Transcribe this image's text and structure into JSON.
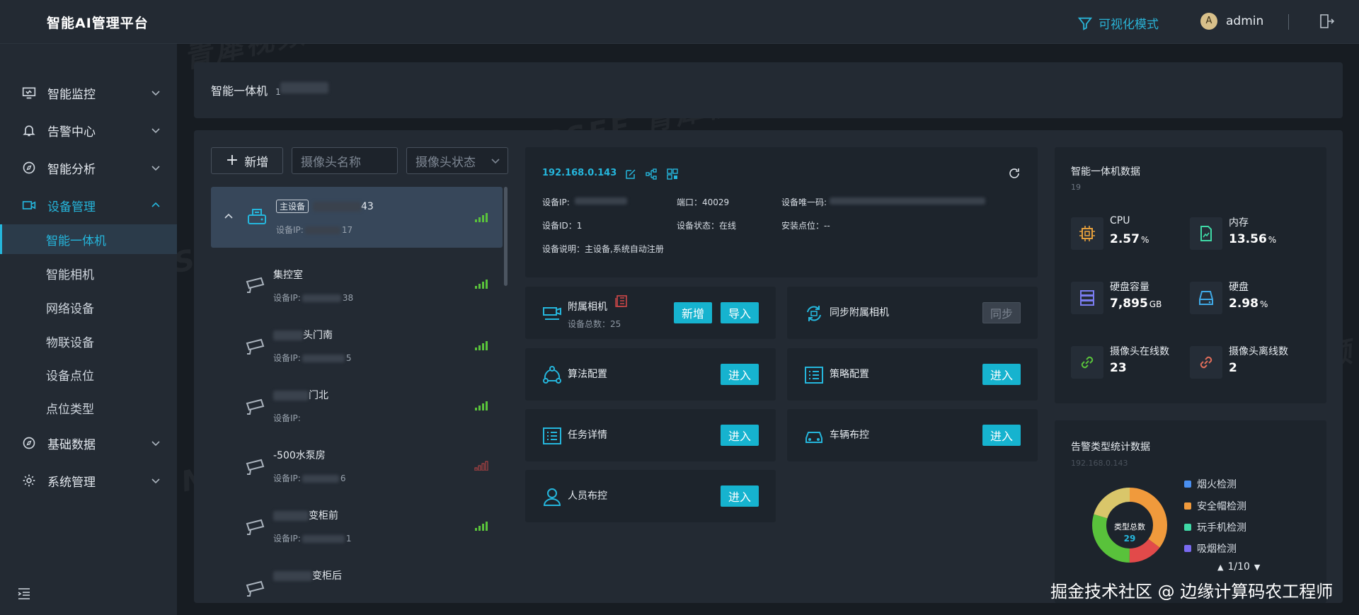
{
  "app": {
    "title": "智能AI管理平台"
  },
  "header": {
    "viz_mode": "可视化模式",
    "avatar_letter": "A",
    "username": "admin"
  },
  "sidebar": {
    "items": [
      {
        "label": "智能监控"
      },
      {
        "label": "告警中心"
      },
      {
        "label": "智能分析"
      },
      {
        "label": "设备管理"
      }
    ],
    "sub_items": [
      {
        "label": "智能一体机"
      },
      {
        "label": "智能相机"
      },
      {
        "label": "网络设备"
      },
      {
        "label": "物联设备"
      },
      {
        "label": "设备点位"
      },
      {
        "label": "点位类型"
      }
    ],
    "items_after": [
      {
        "label": "基础数据"
      },
      {
        "label": "系统管理"
      }
    ]
  },
  "breadcrumb": {
    "title": "智能一体机",
    "suffix": "1"
  },
  "toolbar": {
    "add_label": "新增",
    "name_placeholder": "摄像头名称",
    "status_placeholder": "摄像头状态"
  },
  "devices": [
    {
      "tag": "主设备",
      "name_suffix": "43",
      "ip_label": "设备IP:",
      "ip_suffix": "17",
      "signal": "good"
    },
    {
      "name": "集控室",
      "ip_label": "设备IP:",
      "ip_suffix": "38",
      "signal": "good"
    },
    {
      "name": "头门南",
      "ip_label": "设备IP:",
      "ip_suffix": "5",
      "signal": "good"
    },
    {
      "name": "门北",
      "ip_label": "设备IP:",
      "ip_suffix": "",
      "signal": "good"
    },
    {
      "name": "-500水泵房",
      "ip_label": "设备IP:",
      "ip_suffix": "6",
      "signal": "bad"
    },
    {
      "name": "变柜前",
      "ip_label": "设备IP:",
      "ip_suffix": "1",
      "signal": "good"
    },
    {
      "name": "变柜后",
      "ip_label": "",
      "ip_suffix": "",
      "signal": "good"
    }
  ],
  "detail": {
    "ip": "192.168.0.143",
    "device_ip_label": "设备IP:",
    "port": "端口：40029",
    "unique_label": "设备唯一码:",
    "device_id": "设备ID：1",
    "device_status": "设备状态：在线",
    "install": "安装点位：--",
    "desc": "设备说明：主设备,系统自动注册"
  },
  "cards": {
    "attached_camera": {
      "title": "附属相机",
      "sub": "设备总数：25",
      "add": "新增",
      "import": "导入"
    },
    "sync": {
      "title": "同步附属相机",
      "btn": "同步"
    },
    "algo": {
      "title": "算法配置",
      "btn": "进入"
    },
    "strategy": {
      "title": "策略配置",
      "btn": "进入"
    },
    "task": {
      "title": "任务详情",
      "btn": "进入"
    },
    "vehicle": {
      "title": "车辆布控",
      "btn": "进入"
    },
    "person": {
      "title": "人员布控",
      "btn": "进入"
    }
  },
  "stats": {
    "title": "智能一体机数据",
    "subtitle": "19",
    "cpu": {
      "label": "CPU",
      "value": "2.57",
      "unit": "%"
    },
    "mem": {
      "label": "内存",
      "value": "13.56",
      "unit": "%"
    },
    "disk_cap": {
      "label": "硬盘容量",
      "value": "7,895",
      "unit": "GB"
    },
    "disk": {
      "label": "硬盘",
      "value": "2.98",
      "unit": "%"
    },
    "online": {
      "label": "摄像头在线数",
      "value": "23"
    },
    "offline": {
      "label": "摄像头离线数",
      "value": "2"
    }
  },
  "alarm": {
    "title": "告警类型统计数据",
    "subtitle": "192.168.0.143",
    "center_label": "类型总数",
    "center_value": "29",
    "legend": [
      {
        "label": "烟火检测",
        "color": "#4a8ff0"
      },
      {
        "label": "安全帽检测",
        "color": "#f09a3c"
      },
      {
        "label": "玩手机检测",
        "color": "#3fd9a6"
      },
      {
        "label": "吸烟检测",
        "color": "#7a6af0"
      }
    ],
    "pager": "1/10"
  },
  "credit": "掘金技术社区 @ 边缘计算码农工程师",
  "watermark": "TSINGSEE 青犀视频",
  "colors": {
    "accent": "#25b6dc",
    "button": "#16b3cf",
    "good_signal": "#59c23b",
    "bad_signal": "#c64545"
  }
}
